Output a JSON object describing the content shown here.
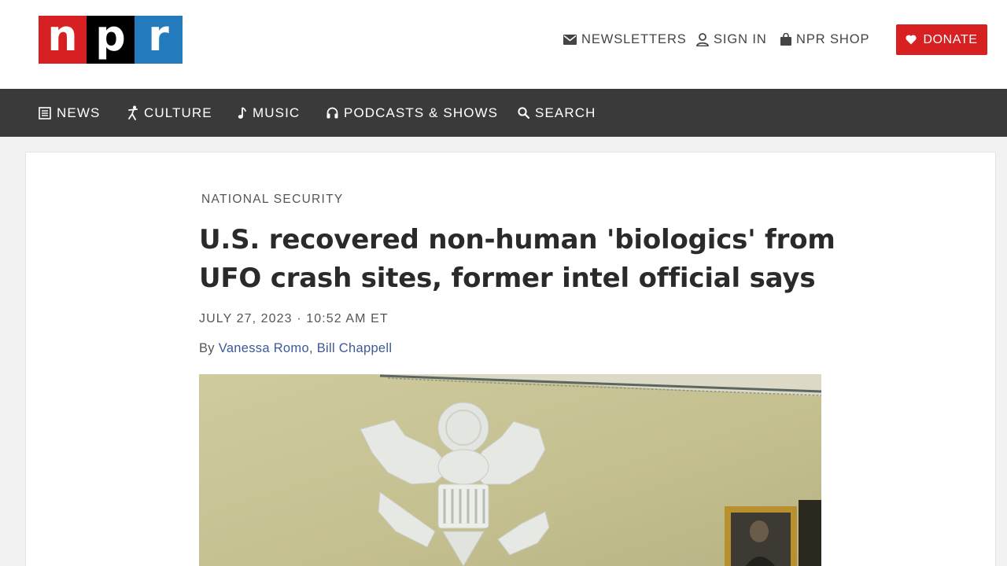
{
  "header": {
    "logo_letters": [
      "n",
      "p",
      "r"
    ],
    "utility_links": [
      {
        "label": "NEWSLETTERS",
        "icon": "envelope-icon"
      },
      {
        "label": "SIGN IN",
        "icon": "user-icon"
      },
      {
        "label": "NPR SHOP",
        "icon": "shopping-bag-icon"
      }
    ],
    "donate_label": "DONATE"
  },
  "nav": {
    "items": [
      {
        "label": "NEWS",
        "icon": "newspaper-icon"
      },
      {
        "label": "CULTURE",
        "icon": "dancer-icon"
      },
      {
        "label": "MUSIC",
        "icon": "music-note-icon"
      },
      {
        "label": "PODCASTS & SHOWS",
        "icon": "headphones-icon"
      },
      {
        "label": "SEARCH",
        "icon": "search-icon"
      }
    ]
  },
  "article": {
    "section": "NATIONAL SECURITY",
    "headline_line1": "U.S. recovered non-human 'biologics' from",
    "headline_line2": "UFO crash sites, former intel official says",
    "dateline": "JULY 27, 2023 · 10:52 AM ET",
    "by_prefix": "By ",
    "authors": [
      "Vanessa Romo",
      "Bill Chappell"
    ],
    "author_separator": ", "
  },
  "colors": {
    "brand_red": "#d62021",
    "brand_blue": "#237bbd",
    "nav_background": "#3a3a3a",
    "link_blue": "#3b5998"
  }
}
